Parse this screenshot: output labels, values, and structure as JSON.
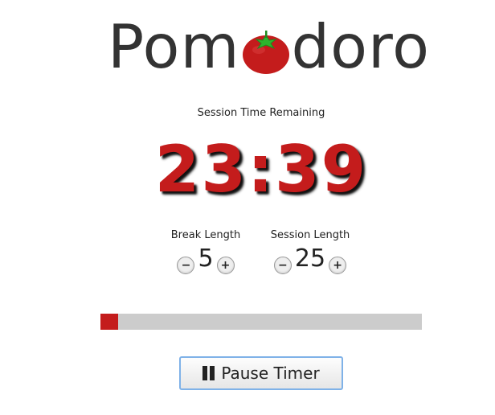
{
  "title": {
    "before_logo": "Pom",
    "after_logo": "doro",
    "logo_icon": "tomato-icon",
    "logo_color": "#c41c1c",
    "leaf_color": "#2db52d"
  },
  "timer": {
    "label": "Session Time Remaining",
    "time": "23:39",
    "color": "#c41c1c"
  },
  "break": {
    "label": "Break Length",
    "value": "5",
    "decrement_label": "−",
    "increment_label": "+"
  },
  "session": {
    "label": "Session Length",
    "value": "25",
    "decrement_label": "−",
    "increment_label": "+"
  },
  "progress": {
    "fraction": 0.054,
    "fill_color": "#c41c1c",
    "track_color": "#cccccc"
  },
  "pause_button": {
    "label": "Pause Timer",
    "icon": "pause-icon"
  }
}
